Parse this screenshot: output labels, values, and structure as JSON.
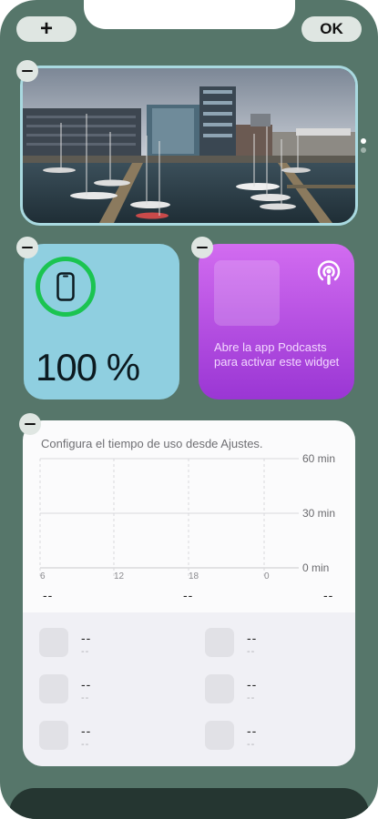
{
  "toolbar": {
    "add_label": "+",
    "done_label": "OK"
  },
  "battery": {
    "value": "100 %",
    "level": 1.0,
    "ring_color": "#1bc451"
  },
  "podcasts": {
    "message": "Abre la app Podcasts para activar este widget"
  },
  "screen_time": {
    "header": "Configura el tiempo de uso desde Ajustes.",
    "y_labels": [
      "60 min",
      "30 min",
      "0 min"
    ],
    "x_labels": [
      "6",
      "12",
      "18",
      "0"
    ],
    "summary": [
      "--",
      "--",
      "--"
    ],
    "apps": [
      {
        "primary": "--",
        "secondary": "--"
      },
      {
        "primary": "--",
        "secondary": "--"
      },
      {
        "primary": "--",
        "secondary": "--"
      },
      {
        "primary": "--",
        "secondary": "--"
      },
      {
        "primary": "--",
        "secondary": "--"
      },
      {
        "primary": "--",
        "secondary": "--"
      }
    ]
  },
  "colors": {
    "background": "#56766a",
    "photo_border": "#a9d9e0",
    "battery_bg": "#8fcfe0",
    "podcast_top": "#d26cf0",
    "podcast_bottom": "#9a36d4"
  }
}
